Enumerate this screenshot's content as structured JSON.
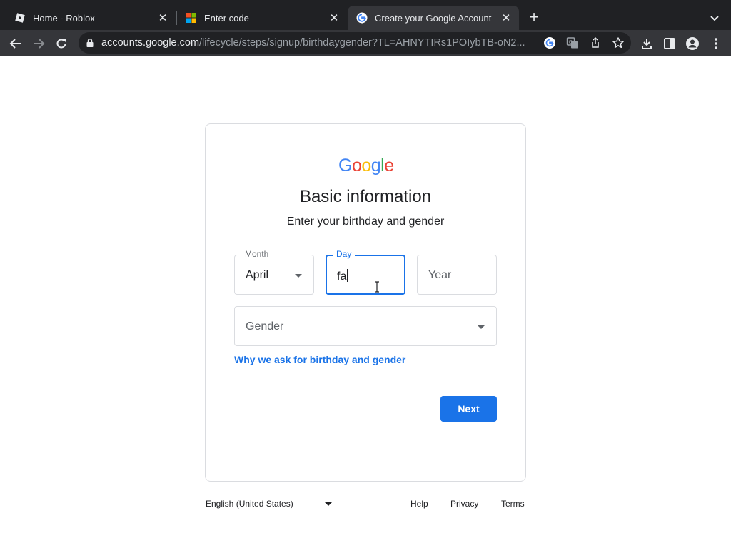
{
  "browser": {
    "tabs": [
      {
        "title": "Home - Roblox",
        "icon": "roblox-icon",
        "active": false
      },
      {
        "title": "Enter code",
        "icon": "microsoft-icon",
        "active": false
      },
      {
        "title": "Create your Google Account",
        "icon": "google-icon",
        "active": true
      }
    ],
    "url_domain": "accounts.google.com",
    "url_path": "/lifecycle/steps/signup/birthdaygender?TL=AHNYTIRs1POIybTB-oN2..."
  },
  "page": {
    "logo_letters": [
      "G",
      "o",
      "o",
      "g",
      "l",
      "e"
    ],
    "logo_colors": [
      "#4285F4",
      "#EA4335",
      "#FBBC05",
      "#4285F4",
      "#34A853",
      "#EA4335"
    ],
    "title": "Basic information",
    "subtitle": "Enter your birthday and gender",
    "month": {
      "label": "Month",
      "value": "April"
    },
    "day": {
      "label": "Day",
      "value": "fa"
    },
    "year": {
      "placeholder": "Year"
    },
    "gender": {
      "placeholder": "Gender"
    },
    "why_link": "Why we ask for birthday and gender",
    "next_label": "Next"
  },
  "footer": {
    "language": "English (United States)",
    "links": [
      "Help",
      "Privacy",
      "Terms"
    ]
  },
  "colors": {
    "accent": "#1a73e8",
    "chrome_dark": "#202124",
    "chrome_toolbar": "#35363a"
  }
}
